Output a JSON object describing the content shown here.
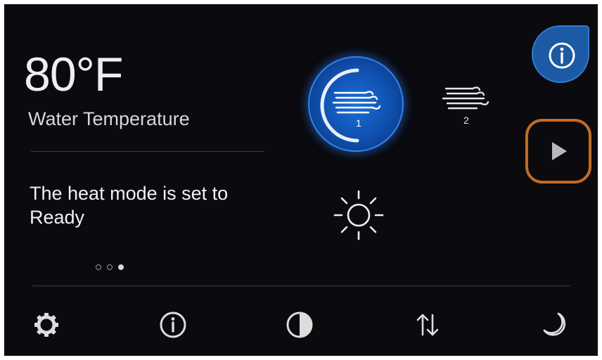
{
  "status": {
    "temperature": "80°F",
    "temperature_label": "Water Temperature",
    "heat_mode_message": "The heat mode is set to Ready"
  },
  "pagination": {
    "total": 3,
    "active_index": 2
  },
  "controls": {
    "jet1": {
      "number": "1",
      "active": true
    },
    "jet2": {
      "number": "2",
      "active": false
    },
    "light": {
      "icon": "sun-icon"
    },
    "info": {
      "icon": "info-icon"
    },
    "play": {
      "icon": "play-icon"
    }
  },
  "toolbar": {
    "icons": [
      "gear-icon",
      "info-icon",
      "contrast-icon",
      "sort-arrows-icon",
      "moon-icon"
    ]
  },
  "colors": {
    "background": "#0a0a0f",
    "accent_blue": "#1b6fd8",
    "highlight_orange": "#c56a22",
    "text": "#eeeeee"
  }
}
